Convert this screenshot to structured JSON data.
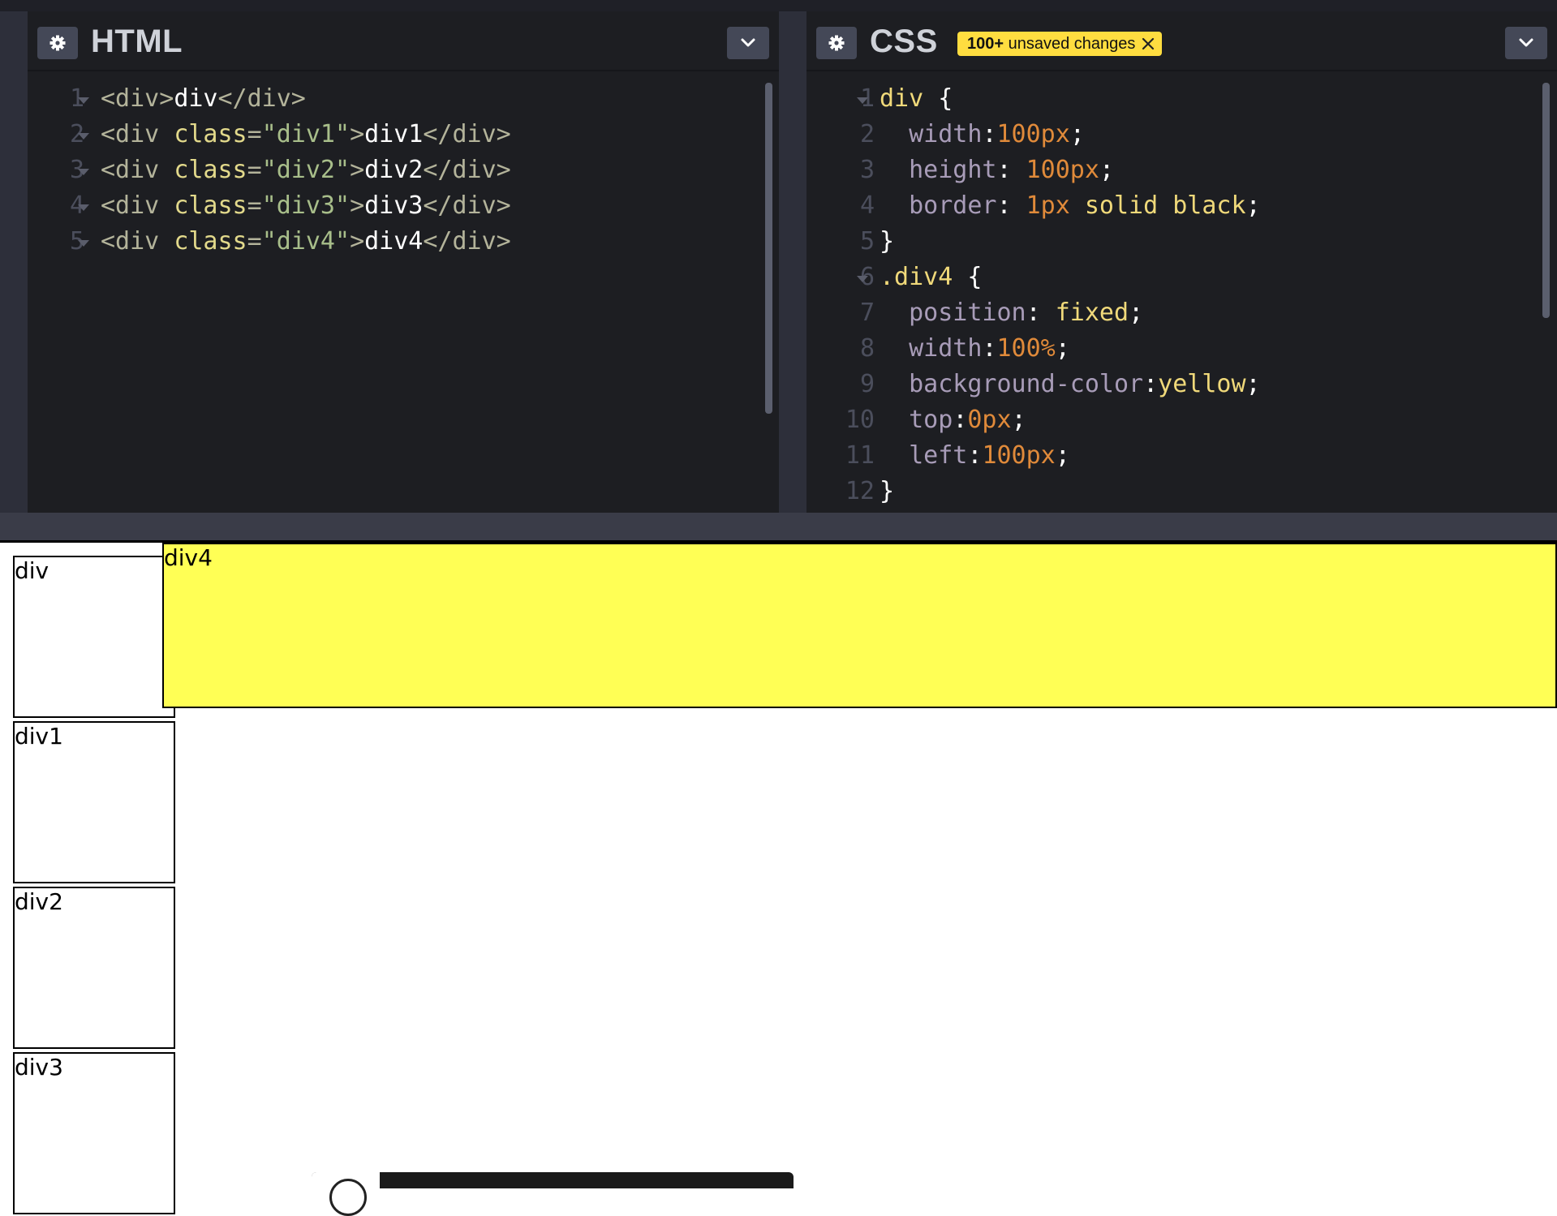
{
  "editors": {
    "html": {
      "title": "HTML",
      "settings_icon": "gear-icon",
      "collapse_icon": "chevron-down-icon",
      "lines": [
        {
          "n": "1",
          "tokens": [
            [
              "tag",
              "<div>"
            ],
            [
              "txt",
              "div"
            ],
            [
              "tag",
              "</div>"
            ]
          ]
        },
        {
          "n": "2",
          "tokens": [
            [
              "tag",
              "<div "
            ],
            [
              "attr",
              "class"
            ],
            [
              "tag",
              "="
            ],
            [
              "str",
              "\"div1\""
            ],
            [
              "tag",
              ">"
            ],
            [
              "txt",
              "div1"
            ],
            [
              "tag",
              "</div>"
            ]
          ]
        },
        {
          "n": "3",
          "tokens": [
            [
              "tag",
              "<div "
            ],
            [
              "attr",
              "class"
            ],
            [
              "tag",
              "="
            ],
            [
              "str",
              "\"div2\""
            ],
            [
              "tag",
              ">"
            ],
            [
              "txt",
              "div2"
            ],
            [
              "tag",
              "</div>"
            ]
          ]
        },
        {
          "n": "4",
          "tokens": [
            [
              "tag",
              "<div "
            ],
            [
              "attr",
              "class"
            ],
            [
              "tag",
              "="
            ],
            [
              "str",
              "\"div3\""
            ],
            [
              "tag",
              ">"
            ],
            [
              "txt",
              "div3"
            ],
            [
              "tag",
              "</div>"
            ]
          ]
        },
        {
          "n": "5",
          "tokens": [
            [
              "tag",
              "<div "
            ],
            [
              "attr",
              "class"
            ],
            [
              "tag",
              "="
            ],
            [
              "str",
              "\"div4\""
            ],
            [
              "tag",
              ">"
            ],
            [
              "txt",
              "div4"
            ],
            [
              "tag",
              "</div>"
            ]
          ]
        }
      ]
    },
    "css": {
      "title": "CSS",
      "badge_bold": "100+",
      "badge_text": "unsaved changes",
      "settings_icon": "gear-icon",
      "collapse_icon": "chevron-down-icon",
      "lines": [
        {
          "n": "1",
          "fold": true,
          "tokens": [
            [
              "sel",
              "div "
            ],
            [
              "punc",
              "{"
            ]
          ]
        },
        {
          "n": "2",
          "tokens": [
            [
              "prop",
              "  width"
            ],
            [
              "punc",
              ":"
            ],
            [
              "num",
              "100px"
            ],
            [
              "punc",
              ";"
            ]
          ]
        },
        {
          "n": "3",
          "tokens": [
            [
              "prop",
              "  height"
            ],
            [
              "punc",
              ": "
            ],
            [
              "num",
              "100px"
            ],
            [
              "punc",
              ";"
            ]
          ]
        },
        {
          "n": "4",
          "tokens": [
            [
              "prop",
              "  border"
            ],
            [
              "punc",
              ": "
            ],
            [
              "num",
              "1px "
            ],
            [
              "kw",
              "solid black"
            ],
            [
              "punc",
              ";"
            ]
          ]
        },
        {
          "n": "5",
          "tokens": [
            [
              "punc",
              "}"
            ]
          ]
        },
        {
          "n": "6",
          "fold": true,
          "tokens": [
            [
              "sel",
              ".div4 "
            ],
            [
              "punc",
              "{"
            ]
          ]
        },
        {
          "n": "7",
          "tokens": [
            [
              "prop",
              "  position"
            ],
            [
              "punc",
              ": "
            ],
            [
              "kw",
              "fixed"
            ],
            [
              "punc",
              ";"
            ]
          ]
        },
        {
          "n": "8",
          "tokens": [
            [
              "prop",
              "  width"
            ],
            [
              "punc",
              ":"
            ],
            [
              "num",
              "100%"
            ],
            [
              "punc",
              ";"
            ]
          ]
        },
        {
          "n": "9",
          "tokens": [
            [
              "prop",
              "  background-color"
            ],
            [
              "punc",
              ":"
            ],
            [
              "kw",
              "yellow"
            ],
            [
              "punc",
              ";"
            ]
          ]
        },
        {
          "n": "10",
          "tokens": [
            [
              "prop",
              "  top"
            ],
            [
              "punc",
              ":"
            ],
            [
              "num",
              "0px"
            ],
            [
              "punc",
              ";"
            ]
          ]
        },
        {
          "n": "11",
          "tokens": [
            [
              "prop",
              "  left"
            ],
            [
              "punc",
              ":"
            ],
            [
              "num",
              "100px"
            ],
            [
              "punc",
              ";"
            ]
          ]
        },
        {
          "n": "12",
          "tokens": [
            [
              "punc",
              "}"
            ]
          ]
        }
      ]
    }
  },
  "preview": {
    "boxes": [
      {
        "name": "preview-div",
        "label": "div"
      },
      {
        "name": "preview-div1",
        "label": "div1"
      },
      {
        "name": "preview-div2",
        "label": "div2"
      },
      {
        "name": "preview-div3",
        "label": "div3"
      },
      {
        "name": "preview-div4",
        "label": "div4"
      }
    ]
  }
}
